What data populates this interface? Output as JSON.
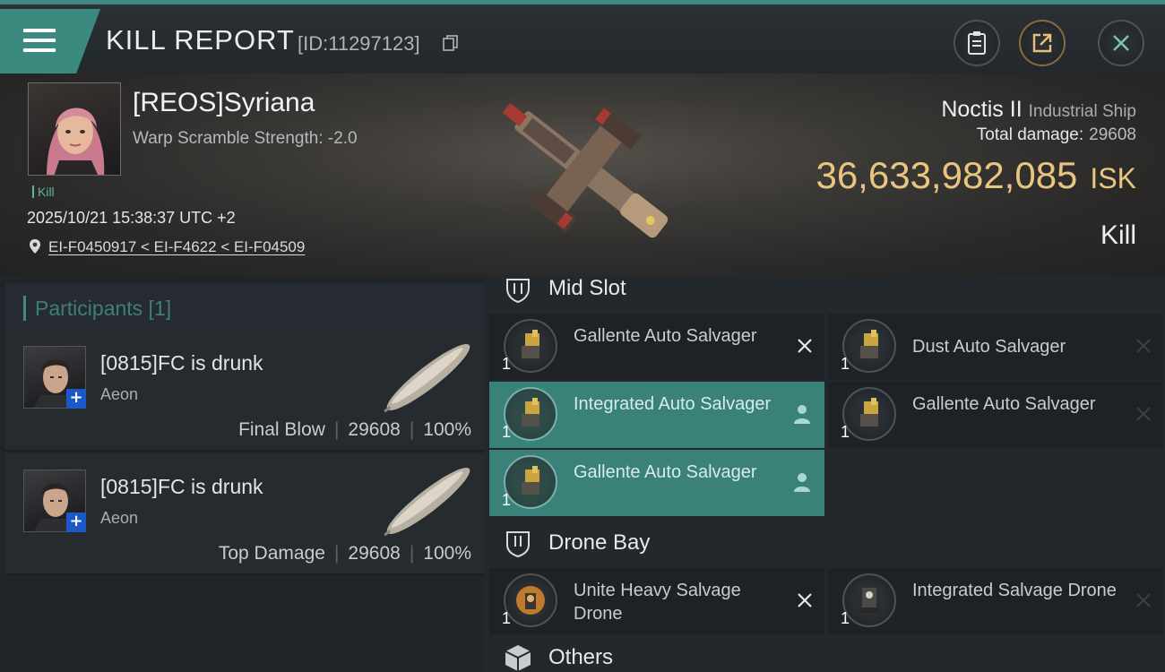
{
  "header": {
    "title": "KILL REPORT",
    "report_id": "[ID:11297123]"
  },
  "victim": {
    "name": "[REOS]Syriana",
    "warp_scramble": "Warp Scramble Strength: -2.0",
    "tag": "Kill",
    "timestamp": "2025/10/21 15:38:37 UTC +2",
    "location": "EI-F0450917 < EI-F4622 < EI-F04509"
  },
  "ship": {
    "name": "Noctis II",
    "class": "Industrial Ship",
    "total_damage_label": "Total damage:",
    "total_damage": "29608",
    "isk_value": "36,633,982,085",
    "isk_unit": "ISK",
    "result": "Kill"
  },
  "participants": {
    "header": "Participants [1]",
    "items": [
      {
        "name": "[0815]FC is drunk",
        "corp": "Aeon",
        "role": "Final Blow",
        "damage": "29608",
        "percent": "100%"
      },
      {
        "name": "[0815]FC is drunk",
        "corp": "Aeon",
        "role": "Top Damage",
        "damage": "29608",
        "percent": "100%"
      }
    ]
  },
  "fitting": {
    "mid_slot_label": "Mid Slot",
    "drone_bay_label": "Drone Bay",
    "others_label": "Others",
    "mid_slot": [
      {
        "name": "Gallente Auto Salvager",
        "qty": "1",
        "status": "destroyed"
      },
      {
        "name": "Dust Auto Salvager",
        "qty": "1",
        "status": "destroyed"
      },
      {
        "name": "Integrated Auto Salvager",
        "qty": "1",
        "status": "dropped"
      },
      {
        "name": "Gallente Auto Salvager",
        "qty": "1",
        "status": "destroyed"
      },
      {
        "name": "Gallente Auto Salvager",
        "qty": "1",
        "status": "dropped"
      }
    ],
    "drone_bay": [
      {
        "name": "Unite Heavy Salvage Drone",
        "qty": "1",
        "status": "destroyed"
      },
      {
        "name": "Integrated Salvage Drone",
        "qty": "1",
        "status": "destroyed"
      }
    ]
  },
  "colors": {
    "accent": "#3a8279",
    "isk": "#e9c680",
    "panel": "#23282c"
  },
  "icons": {
    "menu": "hamburger-icon",
    "copy": "copy-icon",
    "clipboard": "clipboard-icon",
    "share": "share-icon",
    "close": "close-icon",
    "pin": "location-pin-icon",
    "destroyed": "x-icon",
    "dropped": "person-icon"
  }
}
